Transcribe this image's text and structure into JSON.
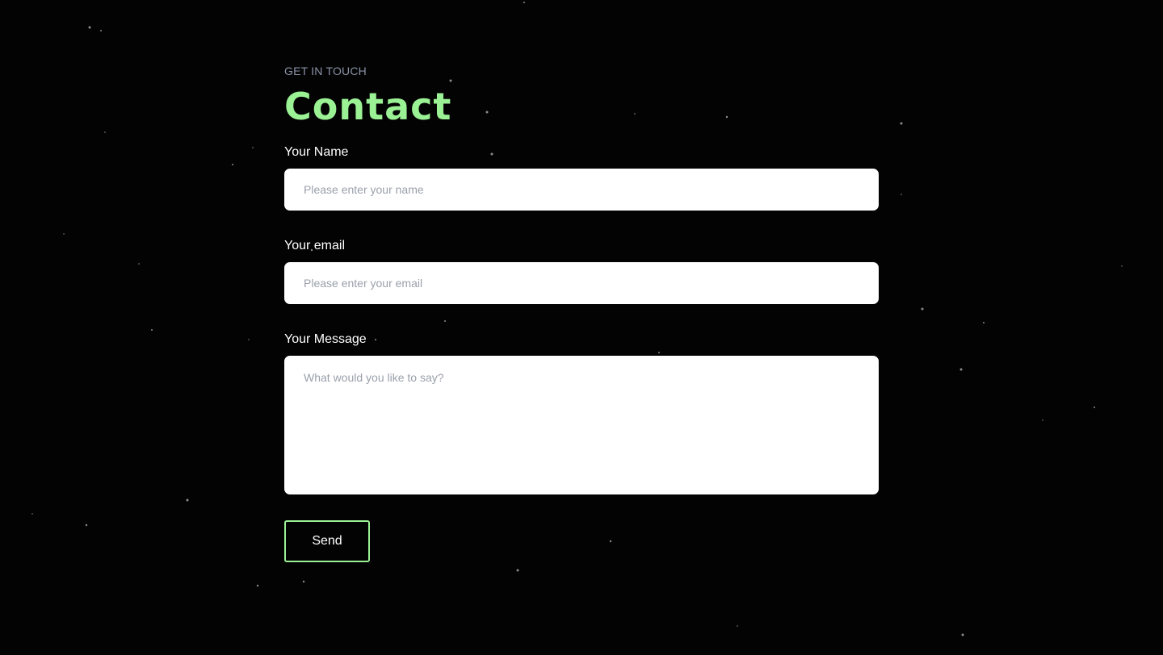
{
  "contact": {
    "eyebrow": "GET IN TOUCH",
    "title": "Contact",
    "name_label": "Your Name",
    "name_placeholder": "Please enter your name",
    "name_value": "",
    "email_label": "Your email",
    "email_placeholder": "Please enter your email",
    "email_value": "",
    "message_label": "Your Message",
    "message_placeholder": "What would you like to say?",
    "message_value": "",
    "send_label": "Send"
  },
  "colors": {
    "background": "#030303",
    "accent": "#9bf294",
    "eyebrow": "#8a93a6",
    "star": "#8c8c8c"
  }
}
